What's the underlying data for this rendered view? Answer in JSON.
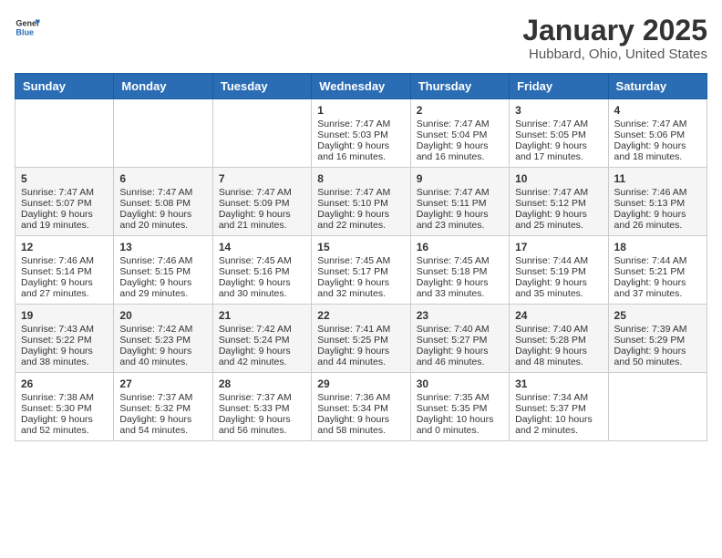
{
  "header": {
    "logo_general": "General",
    "logo_blue": "Blue",
    "title": "January 2025",
    "subtitle": "Hubbard, Ohio, United States"
  },
  "calendar": {
    "days_of_week": [
      "Sunday",
      "Monday",
      "Tuesday",
      "Wednesday",
      "Thursday",
      "Friday",
      "Saturday"
    ],
    "weeks": [
      {
        "days": [
          {
            "number": "",
            "empty": true
          },
          {
            "number": "",
            "empty": true
          },
          {
            "number": "",
            "empty": true
          },
          {
            "number": "1",
            "sunrise": "7:47 AM",
            "sunset": "5:03 PM",
            "daylight": "9 hours and 16 minutes."
          },
          {
            "number": "2",
            "sunrise": "7:47 AM",
            "sunset": "5:04 PM",
            "daylight": "9 hours and 16 minutes."
          },
          {
            "number": "3",
            "sunrise": "7:47 AM",
            "sunset": "5:05 PM",
            "daylight": "9 hours and 17 minutes."
          },
          {
            "number": "4",
            "sunrise": "7:47 AM",
            "sunset": "5:06 PM",
            "daylight": "9 hours and 18 minutes."
          }
        ]
      },
      {
        "days": [
          {
            "number": "5",
            "sunrise": "7:47 AM",
            "sunset": "5:07 PM",
            "daylight": "9 hours and 19 minutes."
          },
          {
            "number": "6",
            "sunrise": "7:47 AM",
            "sunset": "5:08 PM",
            "daylight": "9 hours and 20 minutes."
          },
          {
            "number": "7",
            "sunrise": "7:47 AM",
            "sunset": "5:09 PM",
            "daylight": "9 hours and 21 minutes."
          },
          {
            "number": "8",
            "sunrise": "7:47 AM",
            "sunset": "5:10 PM",
            "daylight": "9 hours and 22 minutes."
          },
          {
            "number": "9",
            "sunrise": "7:47 AM",
            "sunset": "5:11 PM",
            "daylight": "9 hours and 23 minutes."
          },
          {
            "number": "10",
            "sunrise": "7:47 AM",
            "sunset": "5:12 PM",
            "daylight": "9 hours and 25 minutes."
          },
          {
            "number": "11",
            "sunrise": "7:46 AM",
            "sunset": "5:13 PM",
            "daylight": "9 hours and 26 minutes."
          }
        ]
      },
      {
        "days": [
          {
            "number": "12",
            "sunrise": "7:46 AM",
            "sunset": "5:14 PM",
            "daylight": "9 hours and 27 minutes."
          },
          {
            "number": "13",
            "sunrise": "7:46 AM",
            "sunset": "5:15 PM",
            "daylight": "9 hours and 29 minutes."
          },
          {
            "number": "14",
            "sunrise": "7:45 AM",
            "sunset": "5:16 PM",
            "daylight": "9 hours and 30 minutes."
          },
          {
            "number": "15",
            "sunrise": "7:45 AM",
            "sunset": "5:17 PM",
            "daylight": "9 hours and 32 minutes."
          },
          {
            "number": "16",
            "sunrise": "7:45 AM",
            "sunset": "5:18 PM",
            "daylight": "9 hours and 33 minutes."
          },
          {
            "number": "17",
            "sunrise": "7:44 AM",
            "sunset": "5:19 PM",
            "daylight": "9 hours and 35 minutes."
          },
          {
            "number": "18",
            "sunrise": "7:44 AM",
            "sunset": "5:21 PM",
            "daylight": "9 hours and 37 minutes."
          }
        ]
      },
      {
        "days": [
          {
            "number": "19",
            "sunrise": "7:43 AM",
            "sunset": "5:22 PM",
            "daylight": "9 hours and 38 minutes."
          },
          {
            "number": "20",
            "sunrise": "7:42 AM",
            "sunset": "5:23 PM",
            "daylight": "9 hours and 40 minutes."
          },
          {
            "number": "21",
            "sunrise": "7:42 AM",
            "sunset": "5:24 PM",
            "daylight": "9 hours and 42 minutes."
          },
          {
            "number": "22",
            "sunrise": "7:41 AM",
            "sunset": "5:25 PM",
            "daylight": "9 hours and 44 minutes."
          },
          {
            "number": "23",
            "sunrise": "7:40 AM",
            "sunset": "5:27 PM",
            "daylight": "9 hours and 46 minutes."
          },
          {
            "number": "24",
            "sunrise": "7:40 AM",
            "sunset": "5:28 PM",
            "daylight": "9 hours and 48 minutes."
          },
          {
            "number": "25",
            "sunrise": "7:39 AM",
            "sunset": "5:29 PM",
            "daylight": "9 hours and 50 minutes."
          }
        ]
      },
      {
        "days": [
          {
            "number": "26",
            "sunrise": "7:38 AM",
            "sunset": "5:30 PM",
            "daylight": "9 hours and 52 minutes."
          },
          {
            "number": "27",
            "sunrise": "7:37 AM",
            "sunset": "5:32 PM",
            "daylight": "9 hours and 54 minutes."
          },
          {
            "number": "28",
            "sunrise": "7:37 AM",
            "sunset": "5:33 PM",
            "daylight": "9 hours and 56 minutes."
          },
          {
            "number": "29",
            "sunrise": "7:36 AM",
            "sunset": "5:34 PM",
            "daylight": "9 hours and 58 minutes."
          },
          {
            "number": "30",
            "sunrise": "7:35 AM",
            "sunset": "5:35 PM",
            "daylight": "10 hours and 0 minutes."
          },
          {
            "number": "31",
            "sunrise": "7:34 AM",
            "sunset": "5:37 PM",
            "daylight": "10 hours and 2 minutes."
          },
          {
            "number": "",
            "empty": true
          }
        ]
      }
    ]
  }
}
